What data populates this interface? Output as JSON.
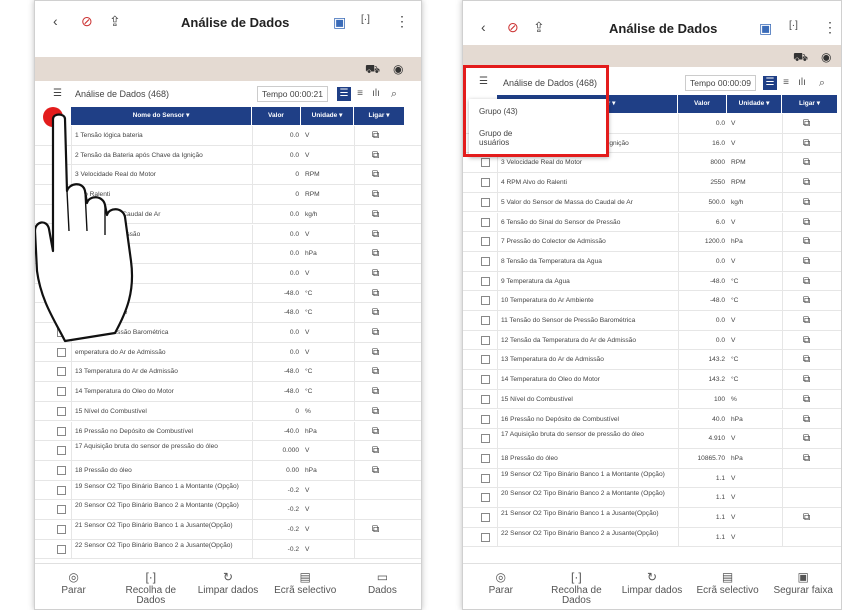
{
  "common": {
    "back_icon": "‹",
    "dtc_icon": "⊘",
    "export_icon": "⇪",
    "title": "Análise de Dados",
    "more_icon": "⋮",
    "capture_icon": "[·]",
    "vci_icon": "▣",
    "car_icon": "⛟",
    "record_icon": "◉",
    "menu_icon": "☰",
    "search_icon": "⌕",
    "link_icon": "⧉",
    "headers": {
      "name": "Nome do Sensor",
      "value": "Valor",
      "unit": "Unidade",
      "link": "Ligar"
    },
    "colors": {
      "header_blue": "#1f3f86",
      "band": "#e4dad2",
      "highlight_red": "#e31c1c",
      "touch_red": "#e31c1c"
    }
  },
  "left": {
    "list_label": "Análise de Dados (468)",
    "time": "Tempo 00:00:21",
    "rows": [
      {
        "name": "1 Tensão lógica bateria",
        "value": "0.0",
        "unit": "V",
        "link": true
      },
      {
        "name": "2 Tensão da Bateria após Chave da Ignição",
        "value": "0.0",
        "unit": "V",
        "link": true
      },
      {
        "name": "3 Velocidade Real do Motor",
        "value": "0",
        "unit": "RPM",
        "link": true
      },
      {
        "name": "o do Ralenti",
        "value": "0",
        "unit": "RPM",
        "link": true
      },
      {
        "name": "or de Massa do Caudal de Ar",
        "value": "0.0",
        "unit": "kg/h",
        "link": true
      },
      {
        "name": "do Sensor de Pressão",
        "value": "0.0",
        "unit": "V",
        "link": true
      },
      {
        "name": "ctor de Admissão",
        "value": "0.0",
        "unit": "hPa",
        "link": true
      },
      {
        "name": "eratura da Água",
        "value": "0.0",
        "unit": "V",
        "link": true
      },
      {
        "name": "a Água",
        "value": "-48.0",
        "unit": "°C",
        "link": true
      },
      {
        "name": "ra do Ar Ambiente",
        "value": "-48.0",
        "unit": "°C",
        "link": true
      },
      {
        "name": "Sensor de Pressão Barométrica",
        "value": "0.0",
        "unit": "V",
        "link": true
      },
      {
        "name": "emperatura do Ar de Admissão",
        "value": "0.0",
        "unit": "V",
        "link": true
      },
      {
        "name": "13 Temperatura do Ar de Admissão",
        "value": "-48.0",
        "unit": "°C",
        "link": true
      },
      {
        "name": "14 Temperatura do Óleo do Motor",
        "value": "-48.0",
        "unit": "°C",
        "link": true
      },
      {
        "name": "15 Nível do Combustível",
        "value": "0",
        "unit": "%",
        "link": true
      },
      {
        "name": "16 Pressão no Depósito de Combustível",
        "value": "-40.0",
        "unit": "hPa",
        "link": true
      },
      {
        "name": "17 Aquisição bruta do sensor de pressão do óleo",
        "value": "0.000",
        "unit": "V",
        "link": true
      },
      {
        "name": "18 Pressão do óleo",
        "value": "0.00",
        "unit": "hPa",
        "link": true
      },
      {
        "name": "19 Sensor O2 Tipo Binário Banco 1 a Montante (Opção)",
        "value": "-0.2",
        "unit": "V",
        "link": false
      },
      {
        "name": "20 Sensor O2 Tipo Binário Banco 2 a Montante (Opção)",
        "value": "-0.2",
        "unit": "V",
        "link": false
      },
      {
        "name": "21 Sensor O2 Tipo Binário Banco 1 a Jusante(Opção)",
        "value": "-0.2",
        "unit": "V",
        "link": true
      },
      {
        "name": "22 Sensor O2 Tipo Binário Banco 2 a Jusante(Opção)",
        "value": "-0.2",
        "unit": "V",
        "link": false
      }
    ],
    "bottom": [
      {
        "icon": "◎",
        "label": "Parar"
      },
      {
        "icon": "[·]",
        "label": "Recolha de Dados"
      },
      {
        "icon": "↻",
        "label": "Limpar dados"
      },
      {
        "icon": "▤",
        "label": "Ecrã selectivo"
      },
      {
        "icon": "▭",
        "label": "Dados"
      }
    ]
  },
  "right": {
    "list_label": "Análise de Dados (468)",
    "time": "Tempo 00:00:09",
    "popup": {
      "item1": "Grupo (43)",
      "item2": "Grupo de usuários"
    },
    "rows": [
      {
        "name": "1 Tensão lógica bateria",
        "value": "0.0",
        "unit": "V",
        "link": true
      },
      {
        "name": "2 Tensão da Bateria após Chave da Ignição",
        "value": "16.0",
        "unit": "V",
        "link": true
      },
      {
        "name": "3 Velocidade Real do Motor",
        "value": "8000",
        "unit": "RPM",
        "link": true
      },
      {
        "name": "4 RPM Alvo do Ralenti",
        "value": "2550",
        "unit": "RPM",
        "link": true
      },
      {
        "name": "5 Valor do Sensor de Massa do Caudal de Ar",
        "value": "500.0",
        "unit": "kg/h",
        "link": true
      },
      {
        "name": "6 Tensão do Sinal do Sensor de Pressão",
        "value": "6.0",
        "unit": "V",
        "link": true
      },
      {
        "name": "7 Pressão do Colector de Admissão",
        "value": "1200.0",
        "unit": "hPa",
        "link": true
      },
      {
        "name": "8 Tensão da Temperatura da Água",
        "value": "0.0",
        "unit": "V",
        "link": true
      },
      {
        "name": "9 Temperatura da Água",
        "value": "-48.0",
        "unit": "°C",
        "link": true
      },
      {
        "name": "10 Temperatura do Ar Ambiente",
        "value": "-48.0",
        "unit": "°C",
        "link": true
      },
      {
        "name": "11 Tensão do Sensor de Pressão Barométrica",
        "value": "0.0",
        "unit": "V",
        "link": true
      },
      {
        "name": "12 Tensão da Temperatura do Ar de Admissão",
        "value": "0.0",
        "unit": "V",
        "link": true
      },
      {
        "name": "13 Temperatura do Ar de Admissão",
        "value": "143.2",
        "unit": "°C",
        "link": true
      },
      {
        "name": "14 Temperatura do Óleo do Motor",
        "value": "143.2",
        "unit": "°C",
        "link": true
      },
      {
        "name": "15 Nível do Combustível",
        "value": "100",
        "unit": "%",
        "link": true
      },
      {
        "name": "16 Pressão no Depósito de Combustível",
        "value": "40.0",
        "unit": "hPa",
        "link": true
      },
      {
        "name": "17 Aquisição bruta do sensor de pressão do óleo",
        "value": "4.910",
        "unit": "V",
        "link": true
      },
      {
        "name": "18 Pressão do óleo",
        "value": "10865.70",
        "unit": "hPa",
        "link": true
      },
      {
        "name": "19 Sensor O2 Tipo Binário Banco 1 a Montante (Opção)",
        "value": "1.1",
        "unit": "V",
        "link": false
      },
      {
        "name": "20 Sensor O2 Tipo Binário Banco 2 a Montante (Opção)",
        "value": "1.1",
        "unit": "V",
        "link": false
      },
      {
        "name": "21 Sensor O2 Tipo Binário Banco 1 a Jusante(Opção)",
        "value": "1.1",
        "unit": "V",
        "link": true
      },
      {
        "name": "22 Sensor O2 Tipo Binário Banco 2 a Jusante(Opção)",
        "value": "1.1",
        "unit": "V",
        "link": false
      }
    ],
    "bottom": [
      {
        "icon": "◎",
        "label": "Parar"
      },
      {
        "icon": "[·]",
        "label": "Recolha de Dados"
      },
      {
        "icon": "↻",
        "label": "Limpar dados"
      },
      {
        "icon": "▤",
        "label": "Ecrã selectivo"
      },
      {
        "icon": "▣",
        "label": "Segurar faixa"
      }
    ]
  }
}
